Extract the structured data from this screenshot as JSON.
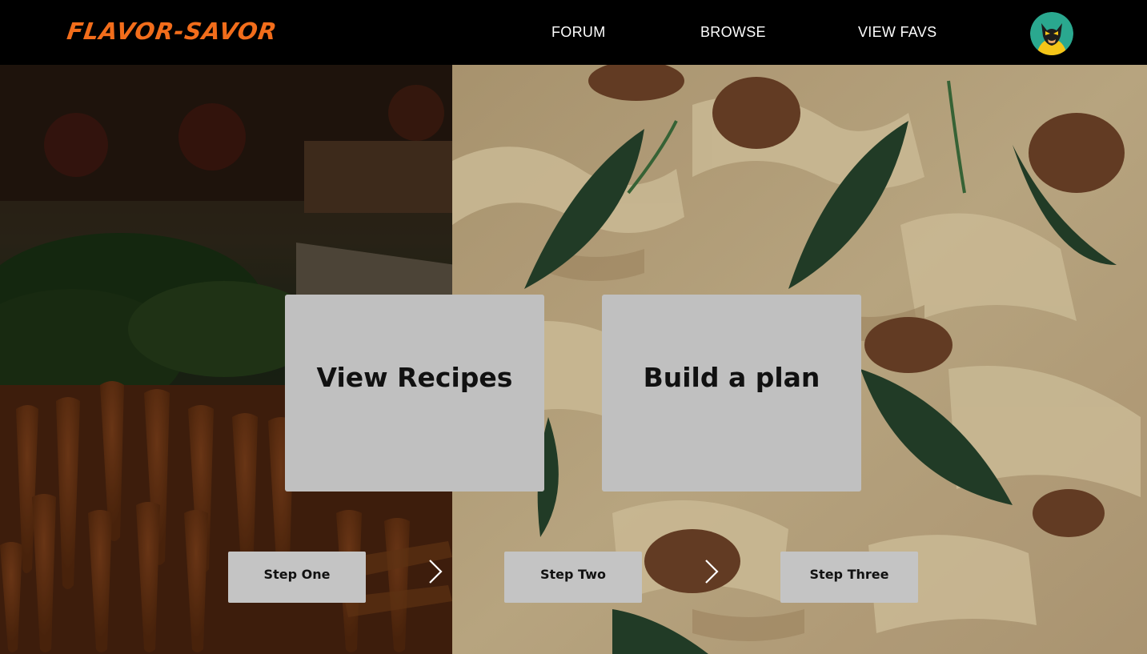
{
  "header": {
    "logo": "FLAVOR-SAVOR",
    "nav": {
      "forum": "FORUM",
      "browse": "BROWSE",
      "favs": "VIEW FAVS"
    },
    "avatar_icon": "masked-hero-avatar"
  },
  "background": {
    "left_image": "carrots-photo",
    "right_image": "pasta-mushroom-photo"
  },
  "cards": {
    "recipes": "View Recipes",
    "plan": "Build a plan"
  },
  "steps": {
    "one": "Step One",
    "two": "Step Two",
    "three": "Step Three"
  },
  "colors": {
    "brand": "#f26d1b",
    "card_bg": "#c0c0c0",
    "avatar_bg": "#2aa88f"
  }
}
